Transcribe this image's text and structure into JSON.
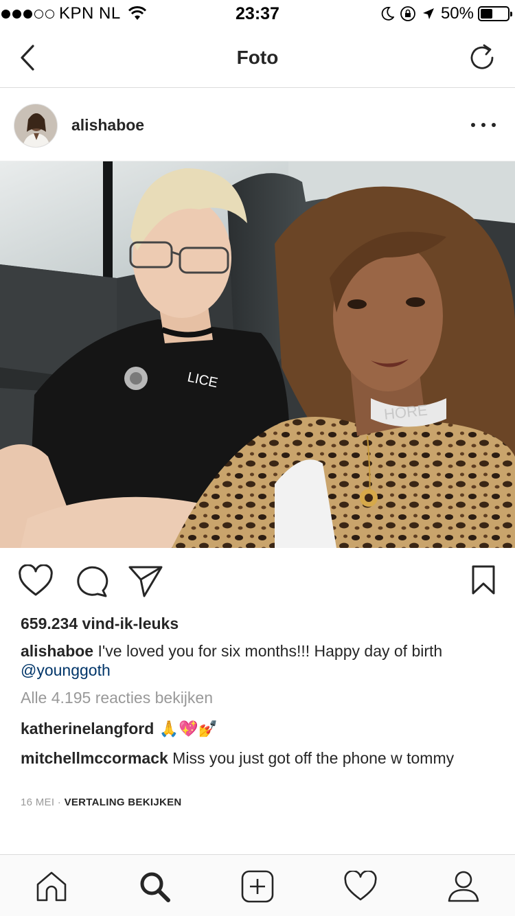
{
  "status_bar": {
    "carrier": "KPN NL",
    "time": "23:37",
    "battery_percent": "50%",
    "battery_level": 0.5,
    "signal_bars_filled": 3,
    "signal_bars_total": 5
  },
  "nav": {
    "title": "Foto",
    "back_icon": "chevron-left-icon",
    "refresh_icon": "refresh-icon"
  },
  "post": {
    "username": "alishaboe",
    "likes": "659.234 vind-ik-leuks",
    "caption": {
      "author": "alishaboe",
      "text": " I've loved you for six months!!! Happy day of birth",
      "mention": "@younggoth"
    },
    "view_comments": "Alle 4.195 reacties bekijken",
    "comments": [
      {
        "author": "katherinelangford",
        "text": " 🙏💖💅"
      },
      {
        "author": "mitchellmccormack",
        "text": " Miss you just got off the phone w tommy"
      }
    ],
    "date": "16 MEI",
    "separator": " · ",
    "translate": "VERTALING BEKIJKEN"
  },
  "tabs": [
    "home-icon",
    "search-icon",
    "add-post-icon",
    "activity-heart-icon",
    "profile-icon"
  ],
  "colors": {
    "text": "#262626",
    "muted": "#999999",
    "mention": "#003569",
    "divider": "#dbdbdb"
  }
}
